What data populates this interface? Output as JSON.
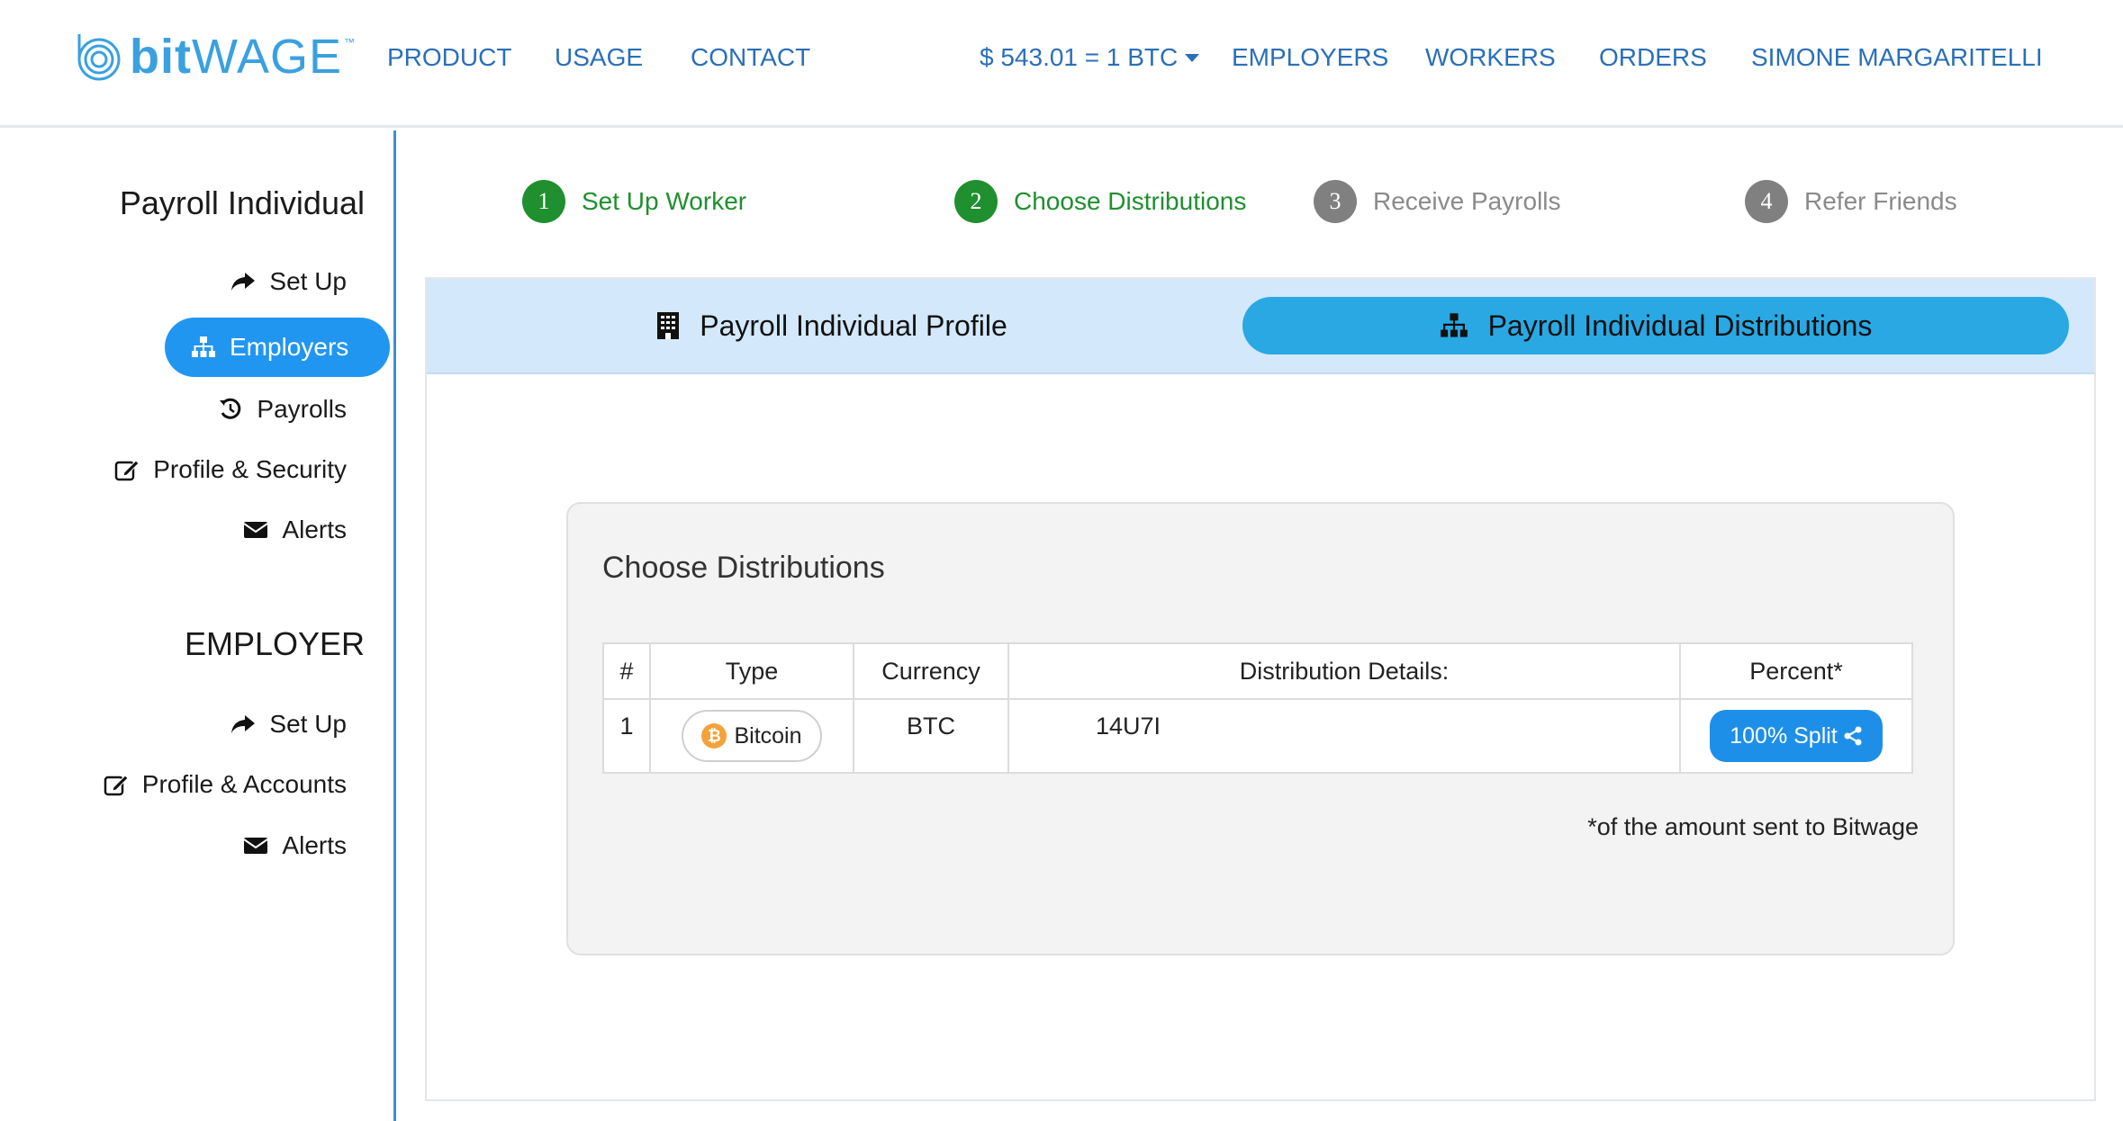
{
  "brand": {
    "name_bold": "bit",
    "name_light": "WAGE",
    "tm": "™"
  },
  "nav": {
    "product": "PRODUCT",
    "usage": "USAGE",
    "contact": "CONTACT",
    "price": "$ 543.01 = 1 BTC",
    "employers": "EMPLOYERS",
    "workers": "WORKERS",
    "orders": "ORDERS",
    "user": "SIMONE MARGARITELLI"
  },
  "sidebar": {
    "section1_title": "Payroll Individual",
    "section1_items": [
      {
        "label": "Set Up",
        "icon": "share-icon"
      },
      {
        "label": "Employers",
        "icon": "sitemap-icon",
        "active": true
      },
      {
        "label": "Payrolls",
        "icon": "history-icon"
      },
      {
        "label": "Profile & Security",
        "icon": "edit-icon"
      },
      {
        "label": "Alerts",
        "icon": "envelope-icon"
      }
    ],
    "section2_title": "EMPLOYER",
    "section2_items": [
      {
        "label": "Set Up",
        "icon": "share-icon"
      },
      {
        "label": "Profile & Accounts",
        "icon": "edit-icon"
      },
      {
        "label": "Alerts",
        "icon": "envelope-icon"
      }
    ]
  },
  "steps": [
    {
      "num": "1",
      "label": "Set Up Worker",
      "state": "done"
    },
    {
      "num": "2",
      "label": "Choose Distributions",
      "state": "done"
    },
    {
      "num": "3",
      "label": "Receive Payrolls",
      "state": "todo"
    },
    {
      "num": "4",
      "label": "Refer Friends",
      "state": "todo"
    }
  ],
  "tabs": {
    "profile": "Payroll Individual Profile",
    "distributions": "Payroll Individual Distributions"
  },
  "card": {
    "title": "Choose Distributions",
    "columns": [
      "#",
      "Type",
      "Currency",
      "Distribution Details:",
      "Percent*"
    ],
    "rows": [
      {
        "num": "1",
        "type": "Bitcoin",
        "currency": "BTC",
        "details": "14U7I",
        "percent": "100% Split"
      }
    ],
    "footnote": "*of the amount sent to Bitwage"
  },
  "colors": {
    "accent": "#2196f0",
    "brand": "#3aa0e0",
    "done": "#1f8f2f",
    "tab_bar": "#d3e8fa",
    "tab_active": "#29a8e3"
  }
}
